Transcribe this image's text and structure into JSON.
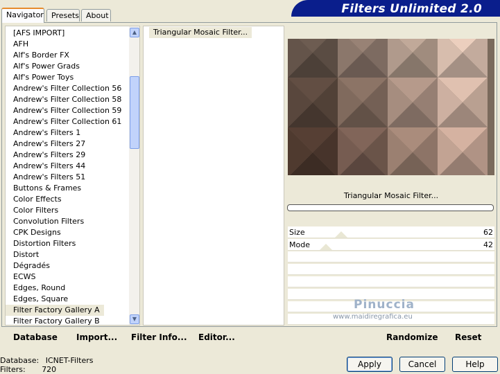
{
  "tabs": [
    {
      "label": "Navigator",
      "active": true
    },
    {
      "label": "Presets",
      "active": false
    },
    {
      "label": "About",
      "active": false
    }
  ],
  "app_title": "Filters Unlimited 2.0",
  "categories": [
    "[AFS IMPORT]",
    "AFH",
    "Alf's Border FX",
    "Alf's Power Grads",
    "Alf's Power Toys",
    "Andrew's Filter Collection 56",
    "Andrew's Filter Collection 58",
    "Andrew's Filter Collection 59",
    "Andrew's Filter Collection 61",
    "Andrew's Filters 1",
    "Andrew's Filters 27",
    "Andrew's Filters 29",
    "Andrew's Filters 44",
    "Andrew's Filters 51",
    "Buttons & Frames",
    "Color Effects",
    "Color Filters",
    "Convolution Filters",
    "CPK Designs",
    "Distortion Filters",
    "Distort",
    "Dégradés",
    "ECWS",
    "Edges, Round",
    "Edges, Square",
    "Filter Factory Gallery A",
    "Filter Factory Gallery B"
  ],
  "selected_category_index": 25,
  "filters": [
    "Triangular Mosaic Filter..."
  ],
  "preview_filter_name": "Triangular Mosaic Filter...",
  "sliders": [
    {
      "label": "Size",
      "value": "62",
      "level": 0.243
    },
    {
      "label": "Mode",
      "value": "42",
      "level": 0.165
    }
  ],
  "watermark": {
    "name": "Pinuccia",
    "url": "www.maidiregrafica.eu"
  },
  "left_buttons": {
    "database": "Database",
    "import": "Import...",
    "filter_info": "Filter Info...",
    "editor": "Editor..."
  },
  "right_buttons": {
    "randomize": "Randomize",
    "reset": "Reset"
  },
  "status": {
    "database_label": "Database:",
    "database_value": "ICNET-Filters",
    "filters_label": "Filters:",
    "filters_value": "720"
  },
  "dialog_buttons": {
    "apply": "Apply",
    "cancel": "Cancel",
    "help": "Help"
  },
  "colors": {
    "banner": "#0a1e8c",
    "selection": "#ece9d8"
  }
}
